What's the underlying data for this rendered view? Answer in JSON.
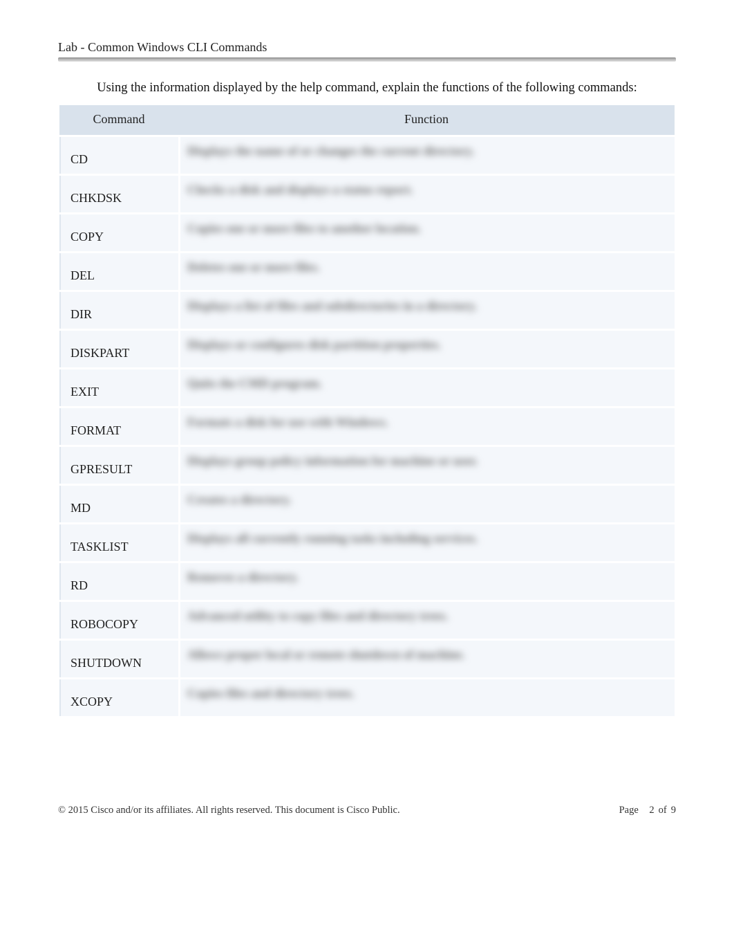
{
  "header": {
    "title": "Lab - Common Windows CLI Commands"
  },
  "intro": "Using the information displayed by the help command, explain the functions of the following commands:",
  "table": {
    "headers": {
      "command": "Command",
      "function": "Function"
    },
    "rows": [
      {
        "command": "CD",
        "function_blur": "Displays the name of or changes the current directory."
      },
      {
        "command": "CHKDSK",
        "function_blur": "Checks a disk and displays a status report."
      },
      {
        "command": "COPY",
        "function_blur": "Copies one or more files to another location."
      },
      {
        "command": "DEL",
        "function_blur": "Deletes one or more files."
      },
      {
        "command": "DIR",
        "function_blur": "Displays a list of files and subdirectories in a directory."
      },
      {
        "command": "DISKPART",
        "function_blur": "Displays or configures disk partition properties."
      },
      {
        "command": "EXIT",
        "function_blur": "Quits the CMD program."
      },
      {
        "command": "FORMAT",
        "function_blur": "Formats a disk for use with Windows."
      },
      {
        "command": "GPRESULT",
        "function_blur": "Displays group policy information for machine or user."
      },
      {
        "command": "MD",
        "function_blur": "Creates a directory."
      },
      {
        "command": "TASKLIST",
        "function_blur": "Displays all currently running tasks including services."
      },
      {
        "command": "RD",
        "function_blur": "Removes a directory."
      },
      {
        "command": "ROBOCOPY",
        "function_blur": "Advanced utility to copy files and directory trees."
      },
      {
        "command": "SHUTDOWN",
        "function_blur": "Allows proper local or remote shutdown of machine."
      },
      {
        "command": "XCOPY",
        "function_blur": "Copies files and directory trees."
      }
    ]
  },
  "footer": {
    "copyright": "© 2015 Cisco and/or its affiliates. All rights reserved. This document is Cisco Public.",
    "page_label": "Page",
    "page_current": "2",
    "page_of": "of",
    "page_total": "9"
  }
}
